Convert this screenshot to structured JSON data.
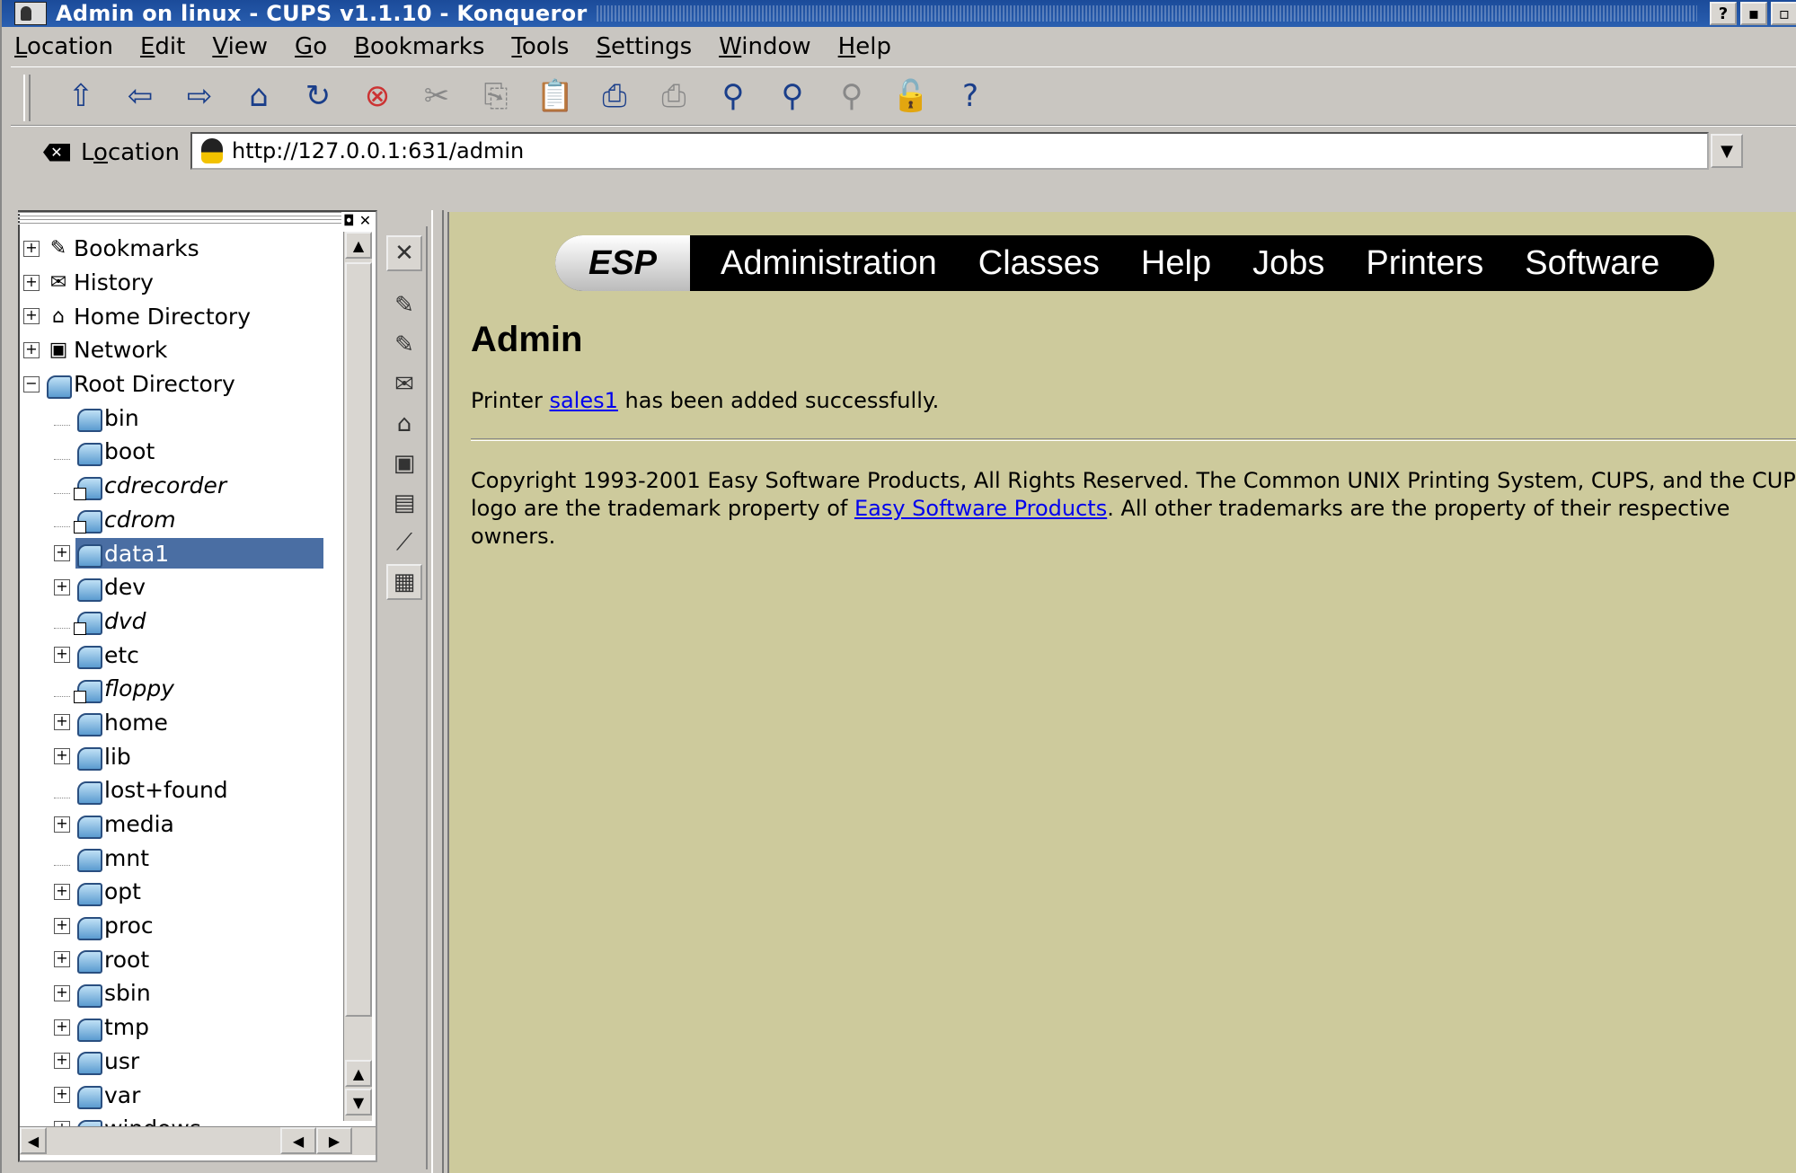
{
  "window": {
    "title": "Admin on linux - CUPS v1.1.10 - Konqueror",
    "buttons": [
      "?",
      "▪",
      "▫"
    ]
  },
  "menubar": [
    {
      "label": "Location",
      "key": "L",
      "rest": "ocation"
    },
    {
      "label": "Edit",
      "key": "E",
      "rest": "dit"
    },
    {
      "label": "View",
      "key": "V",
      "rest": "iew"
    },
    {
      "label": "Go",
      "key": "G",
      "rest": "o"
    },
    {
      "label": "Bookmarks",
      "key": "B",
      "rest": "ookmarks"
    },
    {
      "label": "Tools",
      "key": "T",
      "rest": "ools"
    },
    {
      "label": "Settings",
      "key": "S",
      "rest": "ettings"
    },
    {
      "label": "Window",
      "key": "W",
      "rest": "indow"
    },
    {
      "label": "Help",
      "key": "H",
      "rest": "elp"
    }
  ],
  "toolbar": {
    "icons": [
      "up-arrow-icon",
      "back-arrow-icon",
      "forward-arrow-icon",
      "home-icon",
      "reload-icon",
      "stop-icon",
      "cut-icon",
      "copy-icon",
      "paste-icon",
      "print-icon",
      "print-frame-icon",
      "zoom-icon",
      "zoom-in-icon",
      "zoom-out-icon",
      "lock-icon",
      "help-icon"
    ]
  },
  "location": {
    "label": "Location",
    "label_key": "o",
    "url": "http://127.0.0.1:631/admin"
  },
  "sidebar": {
    "top_items": [
      {
        "label": "Bookmarks",
        "icon": "bookmarks-icon",
        "expander": "+"
      },
      {
        "label": "History",
        "icon": "history-icon",
        "expander": "+"
      },
      {
        "label": "Home Directory",
        "icon": "home-icon",
        "expander": "+"
      },
      {
        "label": "Network",
        "icon": "network-icon",
        "expander": "+"
      },
      {
        "label": "Root Directory",
        "icon": "folder-icon",
        "expander": "−"
      }
    ],
    "root_children": [
      {
        "label": "bin",
        "expander": "",
        "italic": false,
        "link": false
      },
      {
        "label": "boot",
        "expander": "",
        "italic": false,
        "link": false
      },
      {
        "label": "cdrecorder",
        "expander": "",
        "italic": true,
        "link": true
      },
      {
        "label": "cdrom",
        "expander": "",
        "italic": true,
        "link": true
      },
      {
        "label": "data1",
        "expander": "+",
        "italic": false,
        "link": false,
        "selected": true
      },
      {
        "label": "dev",
        "expander": "+",
        "italic": false,
        "link": false
      },
      {
        "label": "dvd",
        "expander": "",
        "italic": true,
        "link": true
      },
      {
        "label": "etc",
        "expander": "+",
        "italic": false,
        "link": false
      },
      {
        "label": "floppy",
        "expander": "",
        "italic": true,
        "link": true
      },
      {
        "label": "home",
        "expander": "+",
        "italic": false,
        "link": false
      },
      {
        "label": "lib",
        "expander": "+",
        "italic": false,
        "link": false
      },
      {
        "label": "lost+found",
        "expander": "",
        "italic": false,
        "link": false
      },
      {
        "label": "media",
        "expander": "+",
        "italic": false,
        "link": false
      },
      {
        "label": "mnt",
        "expander": "",
        "italic": false,
        "link": false
      },
      {
        "label": "opt",
        "expander": "+",
        "italic": false,
        "link": false
      },
      {
        "label": "proc",
        "expander": "+",
        "italic": false,
        "link": false
      },
      {
        "label": "root",
        "expander": "+",
        "italic": false,
        "link": false
      },
      {
        "label": "sbin",
        "expander": "+",
        "italic": false,
        "link": false
      },
      {
        "label": "tmp",
        "expander": "+",
        "italic": false,
        "link": false
      },
      {
        "label": "usr",
        "expander": "+",
        "italic": false,
        "link": false
      },
      {
        "label": "var",
        "expander": "+",
        "italic": false,
        "link": false
      },
      {
        "label": "windows",
        "expander": "+",
        "italic": false,
        "link": false
      }
    ]
  },
  "strip": {
    "icons": [
      "close-icon",
      "services-icon",
      "bookmarks-icon",
      "history-icon",
      "home-icon",
      "network-icon",
      "root-folder-icon",
      "tools-icon",
      "tree-view-icon"
    ]
  },
  "page": {
    "nav": {
      "logo": "ESP",
      "links": [
        "Administration",
        "Classes",
        "Help",
        "Jobs",
        "Printers",
        "Software"
      ]
    },
    "title": "Admin",
    "message_prefix": "Printer ",
    "message_link": "sales1",
    "message_suffix": " has been added successfully.",
    "copyright_1": "Copyright 1993-2001 Easy Software Products, All Rights Reserved. The Common UNIX Printing System, CUPS, and the CUPS logo are the trademark property of ",
    "copyright_link": "Easy Software Products",
    "copyright_2": ". All other trademarks are the property of their respective owners."
  },
  "colors": {
    "content_bg": "#cdca9c",
    "titlebar": "#1b4b9a",
    "selection": "#4a6ea3",
    "link": "#0000ee"
  }
}
